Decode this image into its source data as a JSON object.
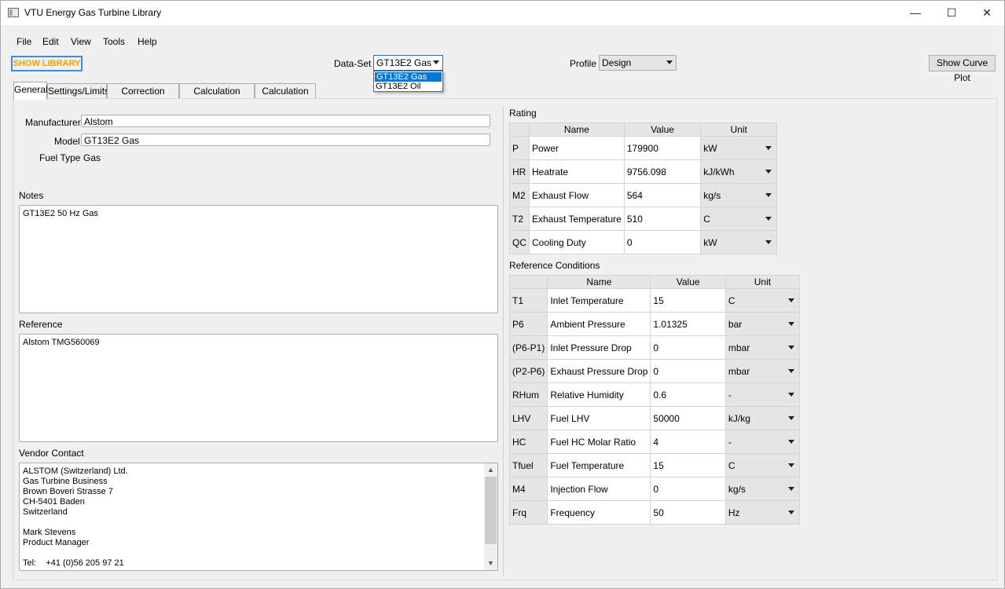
{
  "window": {
    "title": "VTU Energy Gas Turbine Library",
    "minimize_glyph": "—",
    "maximize_glyph": "☐",
    "close_glyph": "✕"
  },
  "menu": [
    "File",
    "Edit",
    "View",
    "Tools",
    "Help"
  ],
  "toolbar": {
    "show_library": "SHOW LIBRARY",
    "dataset_label": "Data-Set",
    "dataset_value": "GT13E2  Gas",
    "dataset_options": [
      "GT13E2  Gas",
      "GT13E2 Oil"
    ],
    "profile_label": "Profile",
    "profile_value": "Design",
    "show_curve_plot": "Show Curve Plot"
  },
  "tabs": [
    "General",
    "Settings/Limits",
    "Correction Curves",
    "Calculation Results",
    "Calculation Log"
  ],
  "general": {
    "manufacturer_label": "Manufacturer",
    "manufacturer": "Alstom",
    "model_label": "Model",
    "model": "GT13E2  Gas",
    "fuel_type_label": "Fuel Type",
    "fuel_type": "Gas",
    "notes_label": "Notes",
    "notes": "GT13E2 50 Hz Gas",
    "reference_label": "Reference",
    "reference": "Alstom TMG560069",
    "vendor_label": "Vendor Contact",
    "vendor_lines": [
      "ALSTOM (Switzerland) Ltd.",
      "Gas Turbine Business",
      "Brown Boveri Strasse 7",
      "CH-5401 Baden",
      "Switzerland",
      "",
      "Mark Stevens",
      "Product Manager",
      "",
      "Tel:    +41 (0)56 205 97 21"
    ]
  },
  "rating": {
    "title": "Rating",
    "headers": [
      "Name",
      "Value",
      "Unit"
    ],
    "rows": [
      {
        "id": "P",
        "name": "Power",
        "value": "179900",
        "unit": "kW"
      },
      {
        "id": "HR",
        "name": "Heatrate",
        "value": "9756.098",
        "unit": "kJ/kWh"
      },
      {
        "id": "M2",
        "name": "Exhaust Flow",
        "value": "564",
        "unit": "kg/s"
      },
      {
        "id": "T2",
        "name": "Exhaust Temperature",
        "value": "510",
        "unit": "C"
      },
      {
        "id": "QC",
        "name": "Cooling Duty",
        "value": "0",
        "unit": "kW"
      }
    ]
  },
  "reference_conditions": {
    "title": "Reference Conditions",
    "headers": [
      "Name",
      "Value",
      "Unit"
    ],
    "rows": [
      {
        "id": "T1",
        "name": "Inlet Temperature",
        "value": "15",
        "unit": "C"
      },
      {
        "id": "P6",
        "name": "Ambient Pressure",
        "value": "1.01325",
        "unit": "bar"
      },
      {
        "id": "(P6-P1)",
        "name": "Inlet Pressure Drop",
        "value": "0",
        "unit": "mbar"
      },
      {
        "id": "(P2-P6)",
        "name": "Exhaust Pressure Drop",
        "value": "0",
        "unit": "mbar"
      },
      {
        "id": "RHum",
        "name": "Relative Humidity",
        "value": "0.6",
        "unit": "-"
      },
      {
        "id": "LHV",
        "name": "Fuel LHV",
        "value": "50000",
        "unit": "kJ/kg"
      },
      {
        "id": "HC",
        "name": "Fuel HC Molar Ratio",
        "value": "4",
        "unit": "-"
      },
      {
        "id": "Tfuel",
        "name": "Fuel Temperature",
        "value": "15",
        "unit": "C"
      },
      {
        "id": "M4",
        "name": "Injection Flow",
        "value": "0",
        "unit": "kg/s"
      },
      {
        "id": "Frq",
        "name": "Frequency",
        "value": "50",
        "unit": "Hz"
      }
    ]
  }
}
